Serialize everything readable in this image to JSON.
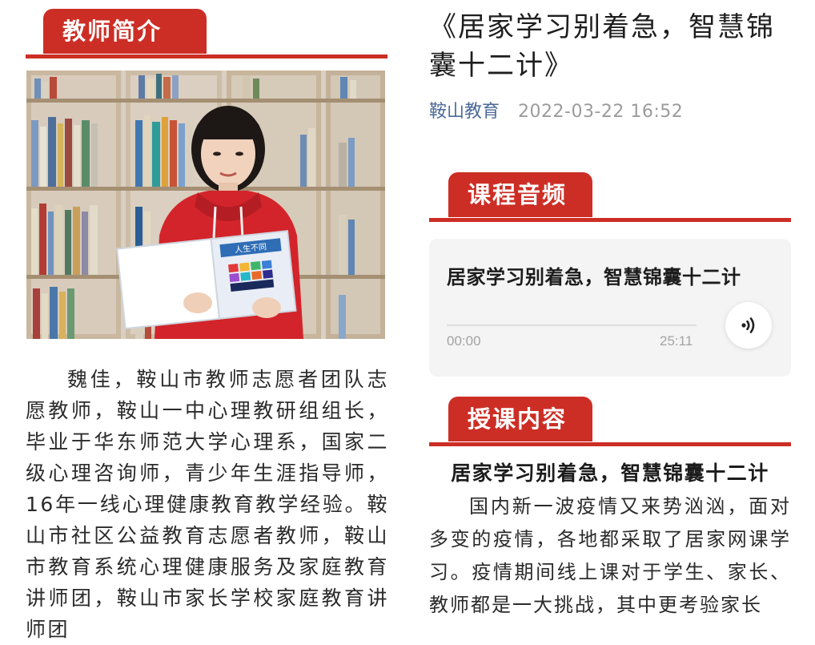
{
  "left": {
    "section_title": "教师简介",
    "photo_alt": "teacher-portrait",
    "book_cover_text": "人生不同",
    "bio": "魏佳，鞍山市教师志愿者团队志愿教师，鞍山一中心理教研组组长，毕业于华东师范大学心理系，国家二级心理咨询师，青少年生涯指导师，16年一线心理健康教育教学经验。鞍山市社区公益教育志愿者教师，鞍山市教育系统心理健康服务及家庭教育讲师团，鞍山市家长学校家庭教育讲师团"
  },
  "article": {
    "title": "《居家学习别着急，智慧锦囊十二计》",
    "author": "鞍山教育",
    "datetime": "2022-03-22 16:52"
  },
  "audio": {
    "section_title": "课程音频",
    "track_title": "居家学习别着急，智慧锦囊十二计",
    "current_time": "00:00",
    "duration": "25:11",
    "progress_fraction": 0
  },
  "lesson": {
    "section_title": "授课内容",
    "heading": "居家学习别着急，智慧锦囊十二计",
    "body": "国内新一波疫情又来势汹汹，面对多变的疫情，各地都采取了居家网课学习。疫情期间线上课对于学生、家长、教师都是一大挑战，其中更考验家长"
  },
  "colors": {
    "accent_red": "#cc2e25",
    "author_blue": "#4c6a99",
    "card_bg": "#f4f4f5"
  },
  "icons": {
    "play": "sound-wave-icon"
  }
}
